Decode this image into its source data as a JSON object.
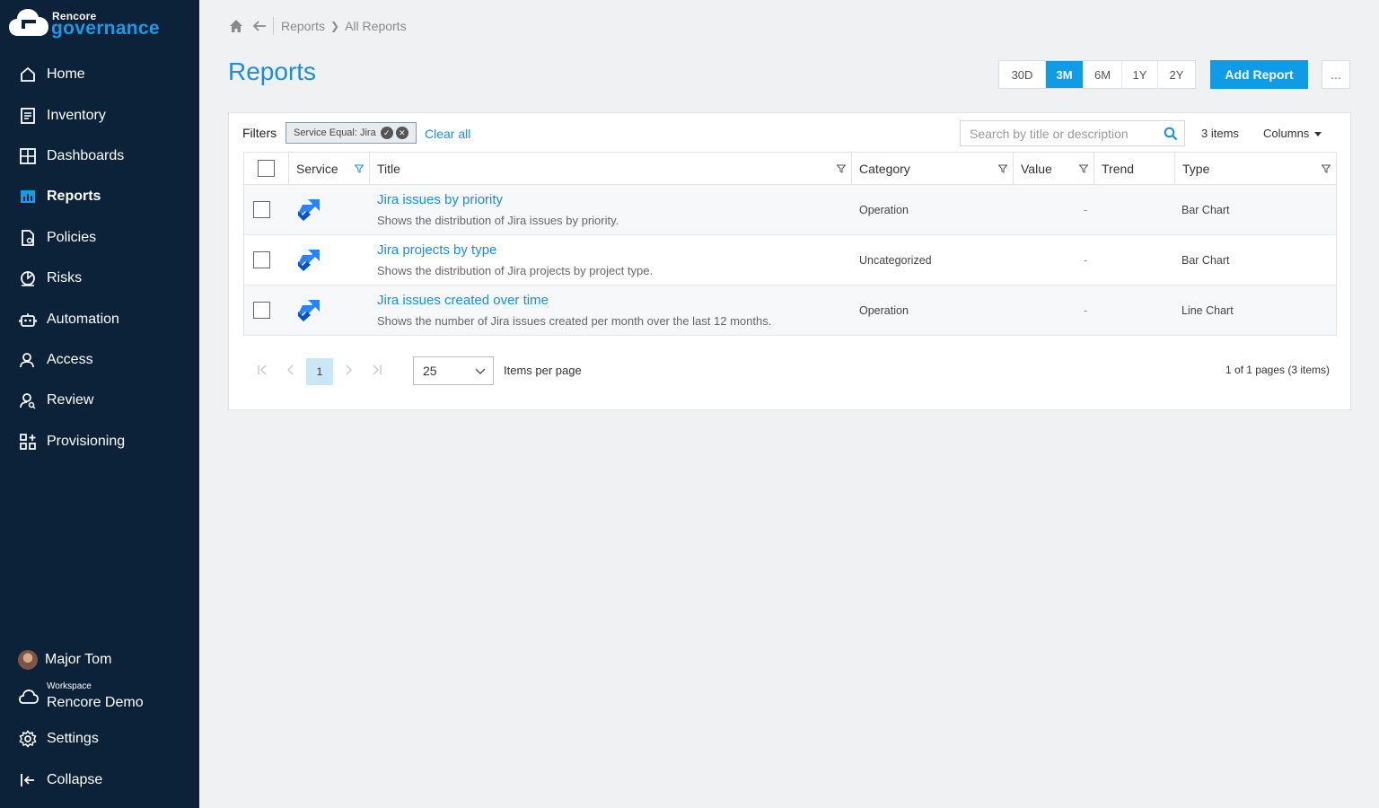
{
  "brand": {
    "top": "Rencore",
    "bottom": "governance"
  },
  "sidebar": {
    "items": [
      {
        "label": "Home",
        "icon": "home-icon"
      },
      {
        "label": "Inventory",
        "icon": "inventory-icon"
      },
      {
        "label": "Dashboards",
        "icon": "dashboards-icon"
      },
      {
        "label": "Reports",
        "icon": "reports-icon",
        "active": true
      },
      {
        "label": "Policies",
        "icon": "policies-icon"
      },
      {
        "label": "Risks",
        "icon": "risks-icon"
      },
      {
        "label": "Automation",
        "icon": "automation-icon"
      },
      {
        "label": "Access",
        "icon": "access-icon"
      },
      {
        "label": "Review",
        "icon": "review-icon"
      },
      {
        "label": "Provisioning",
        "icon": "provisioning-icon"
      }
    ],
    "user": {
      "name": "Major Tom"
    },
    "workspace": {
      "label": "Workspace",
      "name": "Rencore Demo"
    },
    "settings": "Settings",
    "collapse": "Collapse"
  },
  "breadcrumb": {
    "items": [
      "Reports",
      "All Reports"
    ]
  },
  "page": {
    "title": "Reports"
  },
  "ranges": {
    "options": [
      "30D",
      "3M",
      "6M",
      "1Y",
      "2Y"
    ],
    "active": "3M"
  },
  "actions": {
    "add_report": "Add Report",
    "more": "..."
  },
  "filters": {
    "label": "Filters",
    "chip": "Service Equal: Jira",
    "clear_all": "Clear all"
  },
  "search": {
    "placeholder": "Search by title or description"
  },
  "toolbar": {
    "items_count": "3 items",
    "columns": "Columns"
  },
  "table": {
    "columns": [
      "Service",
      "Title",
      "Category",
      "Value",
      "Trend",
      "Type"
    ],
    "rows": [
      {
        "service": "jira",
        "title": "Jira issues by priority",
        "description": "Shows the distribution of Jira issues by priority.",
        "category": "Operation",
        "value": "",
        "trend": "-",
        "type": "Bar Chart"
      },
      {
        "service": "jira",
        "title": "Jira projects by type",
        "description": "Shows the distribution of Jira projects by project type.",
        "category": "Uncategorized",
        "value": "",
        "trend": "-",
        "type": "Bar Chart"
      },
      {
        "service": "jira",
        "title": "Jira issues created over time",
        "description": "Shows the number of Jira issues created per month over the last 12 months.",
        "category": "Operation",
        "value": "",
        "trend": "-",
        "type": "Line Chart"
      }
    ]
  },
  "pager": {
    "current_page": "1",
    "per_page": "25",
    "per_page_label": "Items per page",
    "info": "1 of 1 pages (3 items)"
  },
  "colors": {
    "sidebar_bg": "#0b2239",
    "accent": "#0f9be6",
    "link": "#1a8fd8",
    "jira_blue": "#2684ff"
  }
}
